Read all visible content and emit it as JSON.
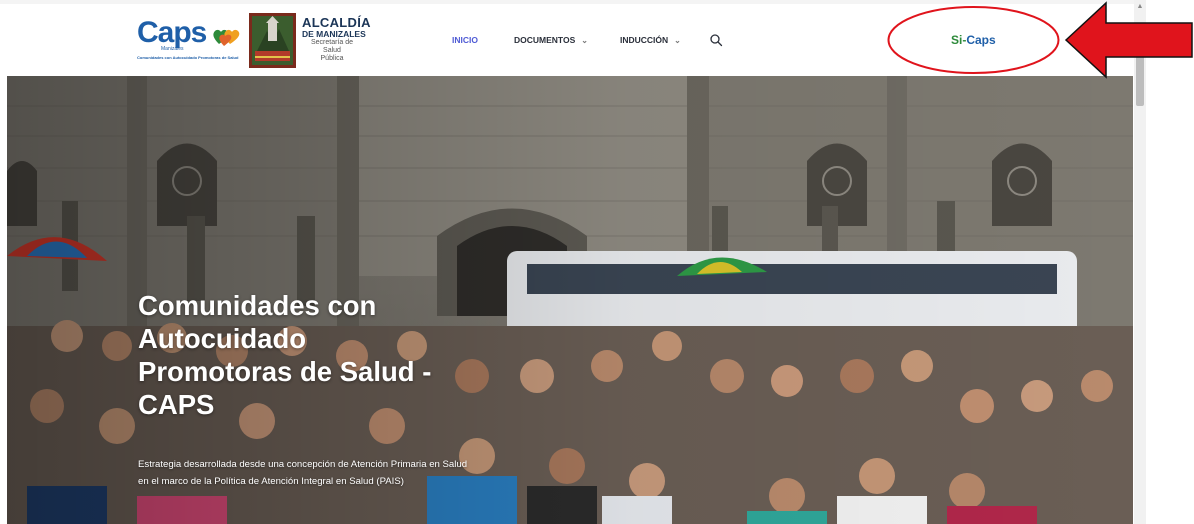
{
  "logos": {
    "caps": {
      "word": "Caps",
      "sub": "Manizales",
      "tagline": "Comunidades con Autocuidado Promotoras de Salud"
    },
    "alcaldia": {
      "line1": "ALCALDÍA",
      "line2": "DE MANIZALES",
      "line3": "Secretaría de Salud",
      "line4": "Pública"
    }
  },
  "nav": {
    "items": [
      {
        "label": "INICIO",
        "active": true
      },
      {
        "label": "DOCUMENTOS",
        "has_dropdown": true
      },
      {
        "label": "INDUCCIÓN",
        "has_dropdown": true
      }
    ],
    "search_icon": "search-icon",
    "cta": {
      "prefix": "Si-",
      "suffix": "Caps"
    }
  },
  "hero": {
    "title_lines": [
      "Comunidades con",
      "Autocuidado",
      "Promotoras de Salud -",
      "CAPS"
    ],
    "subtitle_line1": "Estrategia desarrollada desde una concepción de Atención Primaria en Salud",
    "subtitle_line2": "en el marco de la Política de Atención Integral en Salud (PAIS)"
  },
  "annotation": {
    "color": "#e0141c",
    "arrow_icon": "red-arrow-icon"
  },
  "colors": {
    "accent_nav": "#4f5bd5",
    "brand_blue": "#1f5fa8",
    "brand_green": "#2d8a3a"
  }
}
